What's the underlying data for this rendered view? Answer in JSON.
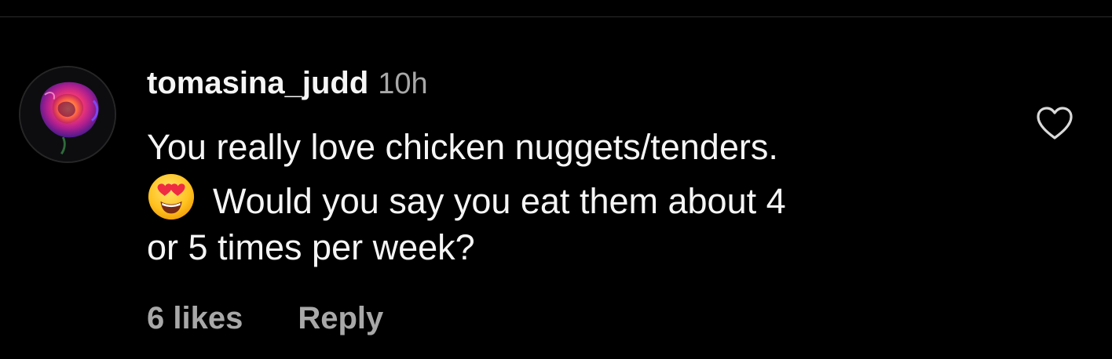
{
  "comment": {
    "username": "tomasina_judd",
    "timestamp": "10h",
    "text_lines": [
      "You really love chicken nuggets/tenders.",
      "Would you say you eat them about 4",
      "or 5 times per week?"
    ],
    "emoji": "heart-eyes-emoji",
    "avatar_icon": "rose-avatar-icon",
    "like_icon": "heart-outline-icon"
  },
  "actions": {
    "likes_label": "6 likes",
    "reply_label": "Reply"
  },
  "colors": {
    "background": "#000000",
    "primary_text": "#f5f5f5",
    "secondary_text": "#a8a8a8",
    "divider": "#2b2b2b"
  }
}
